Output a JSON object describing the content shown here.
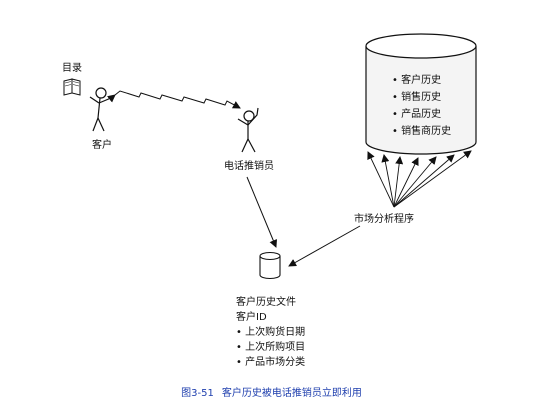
{
  "labels": {
    "catalog": "目录",
    "customer": "客户",
    "telemarketer": "电话推销员",
    "analysis_program": "市场分析程序"
  },
  "database": {
    "items": [
      "客户历史",
      "销售历史",
      "产品历史",
      "销售商历史"
    ]
  },
  "file": {
    "title": "客户历史文件",
    "id_line": "客户ID",
    "items": [
      "上次购货日期",
      "上次所购项目",
      "产品市场分类"
    ]
  },
  "caption": {
    "number": "图3-51",
    "text": "客户历史被电话推销员立即利用"
  },
  "colors": {
    "ink": "#111111",
    "caption": "#1f3fae",
    "cylinder_fill": "#f4f4f4"
  }
}
